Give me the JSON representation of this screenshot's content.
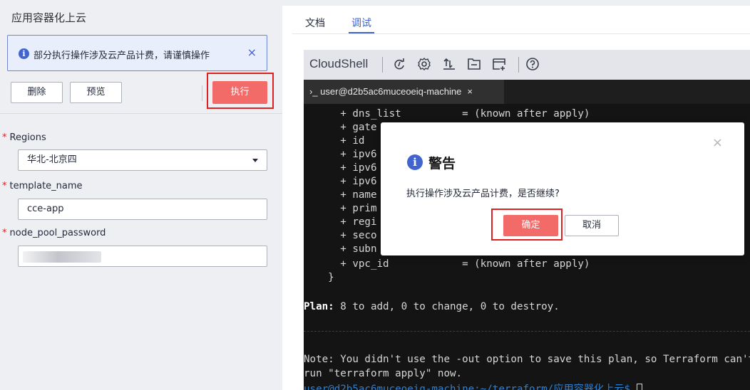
{
  "left": {
    "title": "应用容器化上云",
    "notice": {
      "text": "部分执行操作涉及云产品计费，请谨慎操作",
      "close": "×"
    },
    "buttons": {
      "delete": "删除",
      "preview": "预览",
      "execute": "执行"
    },
    "form": {
      "regions_label": "Regions",
      "regions_value": "华北-北京四",
      "template_name_label": "template_name",
      "template_name_value": "cce-app",
      "node_pool_password_label": "node_pool_password"
    },
    "required_mark": "*"
  },
  "right": {
    "tabs": [
      {
        "label": "文档",
        "active": false
      },
      {
        "label": "调试",
        "active": true
      }
    ],
    "cloudshell": {
      "title": "CloudShell",
      "icons": [
        "refresh-icon",
        "settings-icon",
        "upload-icon",
        "folder-icon",
        "new-window-icon",
        "help-icon"
      ]
    },
    "terminal": {
      "tab_label": "›_ user@d2b5ac6muceoeiq-machine",
      "tab_close": "×",
      "lines": [
        "      + dns_list          = (known after apply)",
        "      + gate",
        "      + id",
        "      + ipv6",
        "      + ipv6",
        "      + ipv6",
        "      + name",
        "      + prim",
        "      + regi",
        "      + seco",
        "      + subn",
        "      + vpc_id            = (known after apply)",
        "    }"
      ],
      "plan_label": "Plan:",
      "plan_text": " 8 to add, 0 to change, 0 to destroy.",
      "note_line1": "Note: You didn't use the -out option to save this plan, so Terraform can't",
      "note_line2": "run \"terraform apply\" now.",
      "prompt": "user@d2b5ac6muceoeiq-machine:~/terraform/应用容器化上云$ "
    }
  },
  "dialog": {
    "title": "警告",
    "message": "执行操作涉及云产品计费，是否继续?",
    "ok": "确定",
    "cancel": "取消",
    "close": "×"
  },
  "colors": {
    "accent": "#4164cf",
    "danger": "#f26b69",
    "highlight_frame": "#e02020",
    "terminal_bg": "#141414"
  }
}
